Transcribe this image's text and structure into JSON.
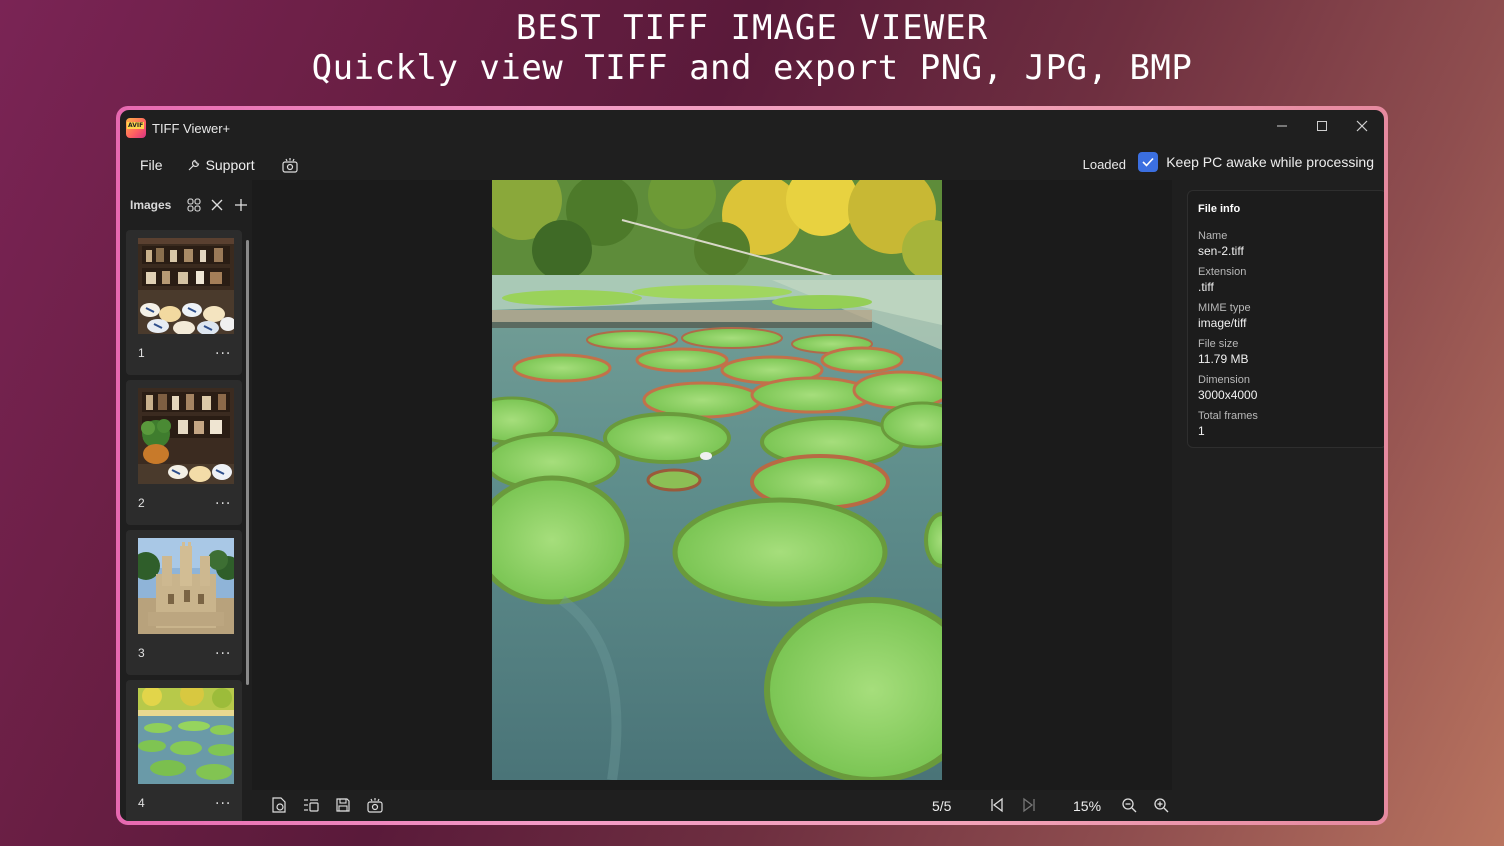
{
  "promo": {
    "line1": "BEST TIFF IMAGE VIEWER",
    "line2": "Quickly view TIFF and export PNG, JPG, BMP"
  },
  "window": {
    "title": "TIFF Viewer+",
    "logo_text": "AVIF",
    "controls": [
      "minimize",
      "maximize",
      "close"
    ]
  },
  "menu": {
    "file": "File",
    "support": "Support",
    "status": "Loaded",
    "keep_awake_label": "Keep PC awake while processing",
    "keep_awake_checked": true
  },
  "sidebar": {
    "title": "Images",
    "thumbnails": [
      {
        "number": "1",
        "more": "...",
        "subject": "shelves-with-bowls"
      },
      {
        "number": "2",
        "more": "...",
        "subject": "shelves-with-plant"
      },
      {
        "number": "3",
        "more": "...",
        "subject": "sand-castle"
      },
      {
        "number": "4",
        "more": "...",
        "subject": "water-lily-pond"
      }
    ]
  },
  "file_info": {
    "title": "File info",
    "name_label": "Name",
    "name": "sen-2.tiff",
    "extension_label": "Extension",
    "extension": ".tiff",
    "mime_label": "MIME type",
    "mime": "image/tiff",
    "size_label": "File size",
    "size": "11.79 MB",
    "dimension_label": "Dimension",
    "dimension": "3000x4000",
    "frames_label": "Total frames",
    "frames": "1"
  },
  "bottom": {
    "page": "5/5",
    "zoom": "15%"
  },
  "colors": {
    "accent": "#3b6fe0",
    "window_bg": "#1f1f1f",
    "border_gradient_start": "#e768b0"
  }
}
